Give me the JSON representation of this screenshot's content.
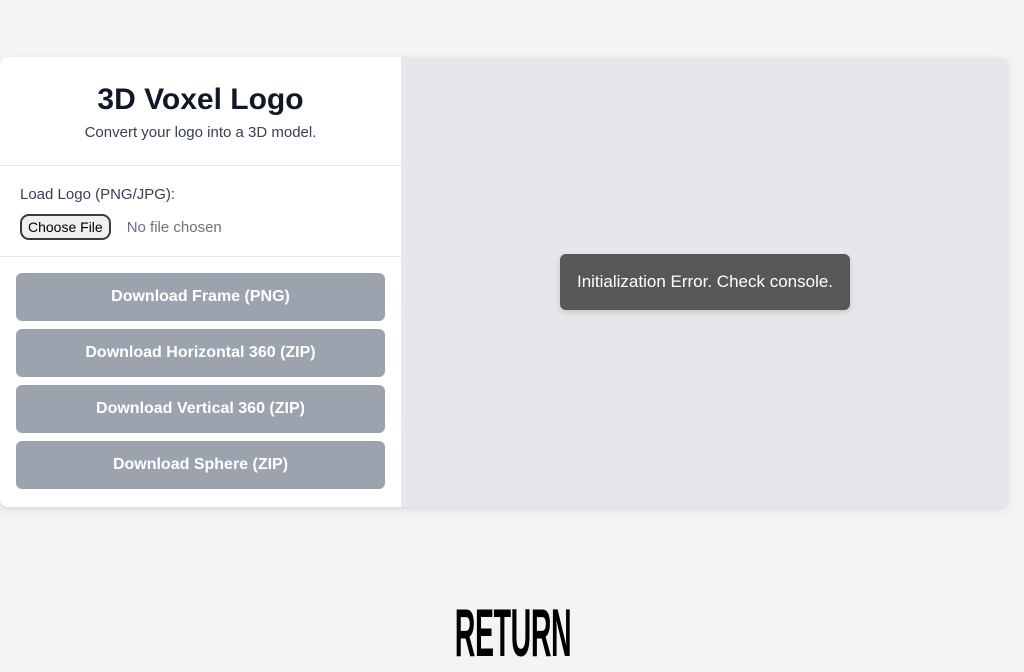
{
  "header": {
    "title": "3D Voxel Logo",
    "subtitle": "Convert your logo into a 3D model."
  },
  "load": {
    "label": "Load Logo (PNG/JPG):",
    "choose_file_label": "Choose File",
    "file_status": "No file chosen"
  },
  "downloads": [
    {
      "label": "Download Frame (PNG)",
      "enabled": false
    },
    {
      "label": "Download Horizontal 360 (ZIP)",
      "enabled": false
    },
    {
      "label": "Download Vertical 360 (ZIP)",
      "enabled": false
    },
    {
      "label": "Download Sphere (ZIP)",
      "enabled": false
    }
  ],
  "viewport": {
    "error_message": "Initialization Error. Check console."
  },
  "footer": {
    "return_label": "RETURN"
  },
  "colors": {
    "page_background": "#f3f4f6",
    "disabled_button": "#9ca3af",
    "viewport_background": "#e5e7eb",
    "toast_background": "#4b4b4b"
  }
}
